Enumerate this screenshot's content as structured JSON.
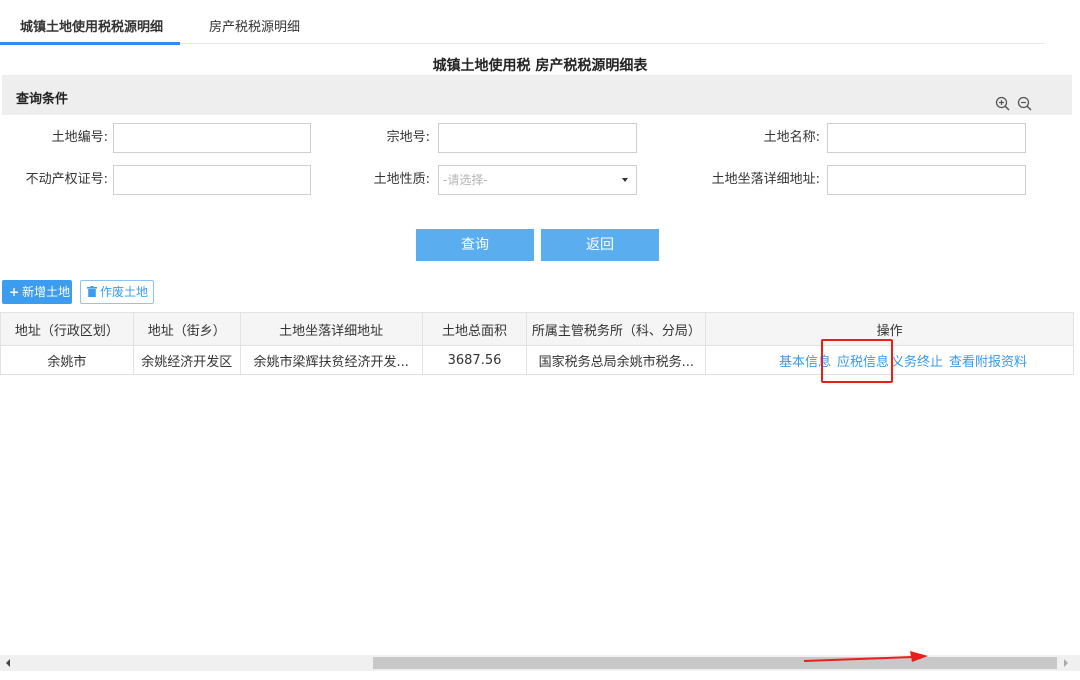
{
  "tabs": [
    "城镇土地使用税税源明细",
    "房产税税源明细"
  ],
  "page_title": "城镇土地使用税  房产税税源明细表",
  "query": {
    "title": "查询条件",
    "fields": {
      "land_no": {
        "label": "土地编号:",
        "value": ""
      },
      "parcel_no": {
        "label": "宗地号:",
        "value": ""
      },
      "land_name": {
        "label": "土地名称:",
        "value": ""
      },
      "property_cert": {
        "label": "不动产权证号:",
        "value": ""
      },
      "land_nature": {
        "label": "土地性质:",
        "placeholder": "-请选择-"
      },
      "land_address": {
        "label": "土地坐落详细地址:",
        "value": ""
      }
    },
    "search_label": "查询",
    "back_label": "返回"
  },
  "toolbar": {
    "add_label": "新增土地",
    "void_label": "作废土地"
  },
  "table": {
    "headers": [
      "地址（行政区划）",
      "地址（街乡）",
      "土地坐落详细地址",
      "土地总面积",
      "所属主管税务所（科、分局）",
      "操作"
    ],
    "rows": [
      {
        "region": "余姚市",
        "street": "余姚经济开发区",
        "address": "余姚市梁辉扶贫经济开发...",
        "area": "3687.56",
        "tax_office": "国家税务总局余姚市税务...",
        "actions": [
          "基本信息",
          "应税信息",
          "义务终止",
          "查看附报资料"
        ]
      }
    ]
  },
  "colors": {
    "accent": "#3c9cf0",
    "button": "#5aaef0",
    "highlight": "#e8201c"
  }
}
